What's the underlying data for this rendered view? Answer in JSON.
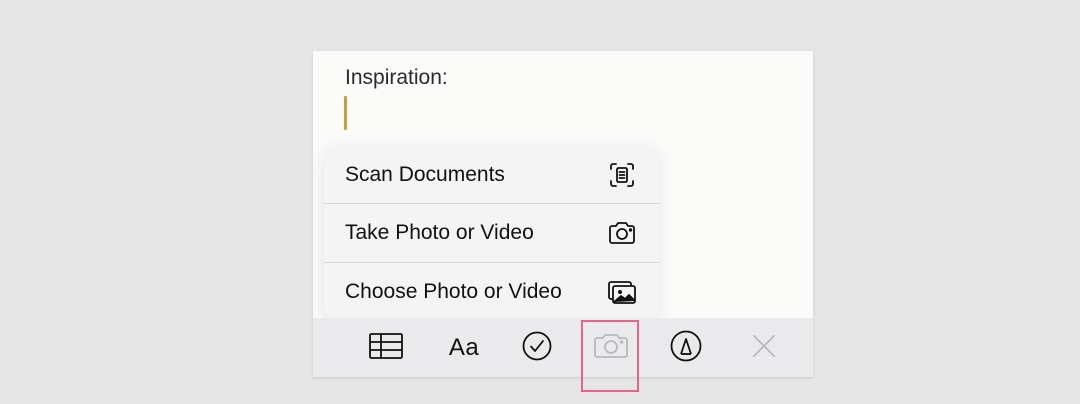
{
  "note": {
    "title": "Inspiration:"
  },
  "attachment_menu": {
    "items": [
      {
        "label": "Scan Documents",
        "icon": "scan-document-icon"
      },
      {
        "label": "Take Photo or Video",
        "icon": "camera-icon"
      },
      {
        "label": "Choose Photo or Video",
        "icon": "photo-library-icon"
      }
    ]
  },
  "toolbar": {
    "items": [
      {
        "icon": "table-icon"
      },
      {
        "label": "Aa",
        "icon": "text-format-icon"
      },
      {
        "icon": "checklist-icon"
      },
      {
        "icon": "camera-icon",
        "state": "active"
      },
      {
        "icon": "markup-pen-icon"
      },
      {
        "icon": "close-icon"
      }
    ]
  },
  "colors": {
    "caret": "#c8a03c",
    "highlight": "#e8628a",
    "inactive_icon": "#b9b9bd"
  }
}
